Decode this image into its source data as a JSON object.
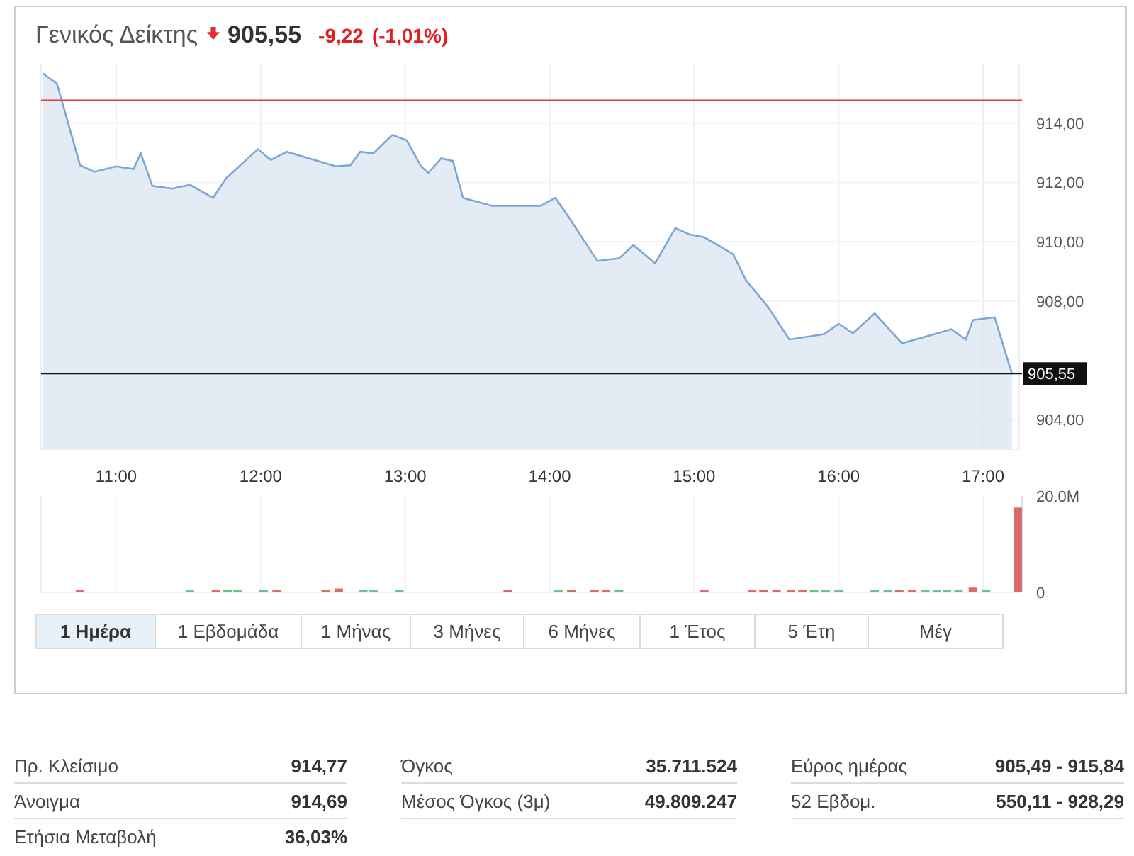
{
  "header": {
    "title": "Γενικός Δείκτης",
    "negative": true,
    "price": "905,55",
    "change": "-9,22",
    "change_percent": "(-1,01%)"
  },
  "price_chart": {
    "chart_data": {
      "type": "area",
      "x": [
        10.49,
        10.59,
        10.75,
        10.85,
        11.0,
        11.12,
        11.17,
        11.25,
        11.39,
        11.51,
        11.67,
        11.76,
        11.98,
        12.07,
        12.18,
        12.52,
        12.62,
        12.69,
        12.78,
        12.91,
        13.01,
        13.11,
        13.16,
        13.25,
        13.33,
        13.4,
        13.6,
        13.94,
        14.04,
        14.14,
        14.33,
        14.48,
        14.58,
        14.73,
        14.87,
        14.97,
        15.07,
        15.27,
        15.36,
        15.51,
        15.66,
        15.9,
        16.0,
        16.1,
        16.25,
        16.44,
        16.69,
        16.78,
        16.88,
        16.93,
        17.08,
        17.2
      ],
      "series": [
        {
          "color": "#7aa7d6",
          "values": [
            915.68,
            915.33,
            912.58,
            912.36,
            912.54,
            912.45,
            912.98,
            911.88,
            911.79,
            911.92,
            911.48,
            912.14,
            913.12,
            912.76,
            913.03,
            912.54,
            912.58,
            913.03,
            912.98,
            913.6,
            913.42,
            912.54,
            912.32,
            912.81,
            912.72,
            911.48,
            911.21,
            911.21,
            911.48,
            910.77,
            909.35,
            909.44,
            909.88,
            909.27,
            910.46,
            910.24,
            910.15,
            909.58,
            908.69,
            907.81,
            906.7,
            906.88,
            907.23,
            906.92,
            907.58,
            906.57,
            906.92,
            907.05,
            906.7,
            907.36,
            907.45,
            905.55
          ]
        }
      ],
      "xlim": [
        10.48,
        17.25
      ],
      "ylim": [
        903.0,
        916.0
      ],
      "xticks": [
        {
          "value": 11,
          "label": "11:00"
        },
        {
          "value": 12,
          "label": "12:00"
        },
        {
          "value": 13,
          "label": "13:00"
        },
        {
          "value": 14,
          "label": "14:00"
        },
        {
          "value": 15,
          "label": "15:00"
        },
        {
          "value": 16,
          "label": "16:00"
        },
        {
          "value": 17,
          "label": "17:00"
        }
      ],
      "yticks": [
        {
          "value": 904,
          "label": "904,00"
        },
        {
          "value": 908,
          "label": "908,00"
        },
        {
          "value": 910,
          "label": "910,00"
        },
        {
          "value": 912,
          "label": "912,00"
        },
        {
          "value": 914,
          "label": "914,00"
        }
      ],
      "grid": true,
      "ref_lines": [
        {
          "axis": "y",
          "value": 914.77,
          "color": "#e03c3c"
        },
        {
          "axis": "y",
          "value": 905.55,
          "color": "#111111",
          "label": "905,55"
        }
      ]
    }
  },
  "volume_chart": {
    "chart_data": {
      "type": "bar",
      "x": [
        10.75,
        11.51,
        11.69,
        11.77,
        11.84,
        12.02,
        12.11,
        12.45,
        12.54,
        12.71,
        12.78,
        12.96,
        13.71,
        14.06,
        14.15,
        14.31,
        14.39,
        14.48,
        15.07,
        15.4,
        15.48,
        15.57,
        15.67,
        15.75,
        15.83,
        15.91,
        16.0,
        16.25,
        16.34,
        16.42,
        16.51,
        16.6,
        16.68,
        16.75,
        16.83,
        16.93,
        17.02,
        17.24
      ],
      "series": [
        {
          "color": "#d96b6b",
          "values": [
            0.3,
            null,
            0.3,
            null,
            null,
            null,
            0.3,
            0.3,
            0.8,
            null,
            null,
            null,
            0.3,
            null,
            0.3,
            0.3,
            0.3,
            null,
            0.3,
            0.3,
            0.3,
            0.3,
            0.3,
            0.3,
            null,
            null,
            null,
            null,
            null,
            0.3,
            0.3,
            null,
            null,
            null,
            null,
            1.0,
            null,
            17.6
          ]
        },
        {
          "color": "#6cc08b",
          "values": [
            null,
            0.5,
            null,
            0.3,
            0.3,
            0.3,
            null,
            null,
            null,
            0.3,
            0.3,
            0.3,
            null,
            0.3,
            null,
            null,
            null,
            0.3,
            null,
            null,
            null,
            null,
            null,
            null,
            0.3,
            0.3,
            0.3,
            0.3,
            0.3,
            null,
            null,
            0.3,
            0.3,
            0.3,
            0.3,
            null,
            0.6,
            null
          ]
        }
      ],
      "xlim": [
        10.48,
        17.25
      ],
      "ylim": [
        0,
        20
      ],
      "yticks": [
        {
          "value": 0,
          "label": "0"
        },
        {
          "value": 20,
          "label": "20.0M"
        }
      ],
      "stacked": true,
      "grid": true
    }
  },
  "periods": [
    {
      "label": "1 Ημέρα",
      "selected": true
    },
    {
      "label": "1 Εβδομάδα",
      "selected": false
    },
    {
      "label": "1 Μήνας",
      "selected": false
    },
    {
      "label": "3 Μήνες",
      "selected": false
    },
    {
      "label": "6 Μήνες",
      "selected": false
    },
    {
      "label": "1 Έτος",
      "selected": false
    },
    {
      "label": "5 Έτη",
      "selected": false
    },
    {
      "label": "Μέγ",
      "selected": false
    }
  ],
  "stats": [
    [
      {
        "label": "Πρ. Κλείσιμο",
        "value": "914,77"
      },
      {
        "label": "Άνοιγμα",
        "value": "914,69"
      },
      {
        "label": "Ετήσια Μεταβολή",
        "value": "36,03%"
      }
    ],
    [
      {
        "label": "Όγκος",
        "value": "35.711.524"
      },
      {
        "label": "Μέσος Όγκος (3μ)",
        "value": "49.809.247"
      }
    ],
    [
      {
        "label": "Εύρος ημέρας",
        "value": "905,49 - 915,84"
      },
      {
        "label": "52 Εβδομ.",
        "value": "550,11 - 928,29"
      }
    ]
  ]
}
